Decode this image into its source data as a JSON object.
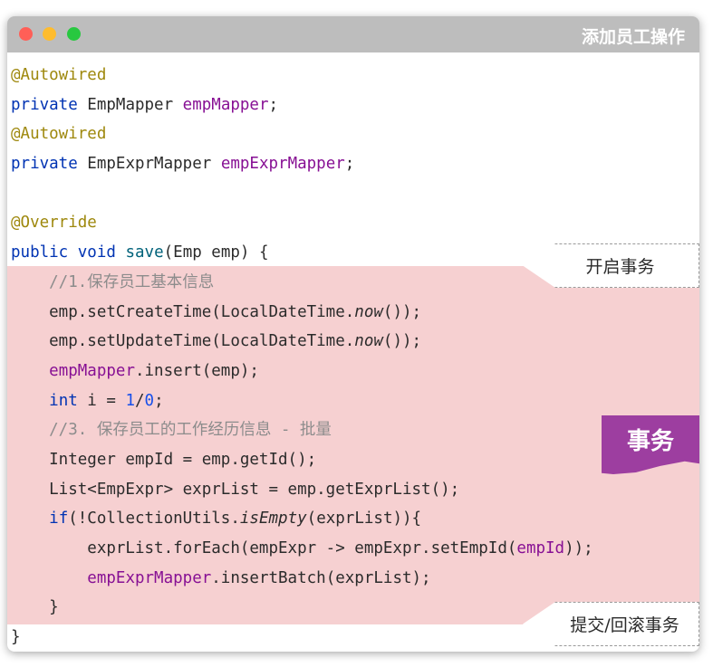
{
  "window": {
    "title": "添加员工操作",
    "controls": [
      "close-icon",
      "minimize-icon",
      "zoom-icon"
    ]
  },
  "code_lines": [
    "@Autowired",
    "private EmpMapper empMapper;",
    "@Autowired",
    "private EmpExprMapper empExprMapper;",
    "",
    "@Override",
    "public void save(Emp emp) {",
    "    //1.保存员工基本信息",
    "    emp.setCreateTime(LocalDateTime.now());",
    "    emp.setUpdateTime(LocalDateTime.now());",
    "    empMapper.insert(emp);",
    "    int i = 1/0;",
    "    //3. 保存员工的工作经历信息 - 批量",
    "    Integer empId = emp.getId();",
    "    List<EmpExpr> exprList = emp.getExprList();",
    "    if(!CollectionUtils.isEmpty(exprList)){",
    "        exprList.forEach(empExpr -> empExpr.setEmpId(empId));",
    "        empExprMapper.insertBatch(exprList);",
    "    }",
    "}"
  ],
  "annotations": {
    "start": "开启事务",
    "transaction": "事务",
    "commit": "提交/回滚事务"
  },
  "colors": {
    "titlebar": "#bdbdbd",
    "transaction_highlight": "#f6d0d1",
    "badge": "#9d3ea0"
  }
}
